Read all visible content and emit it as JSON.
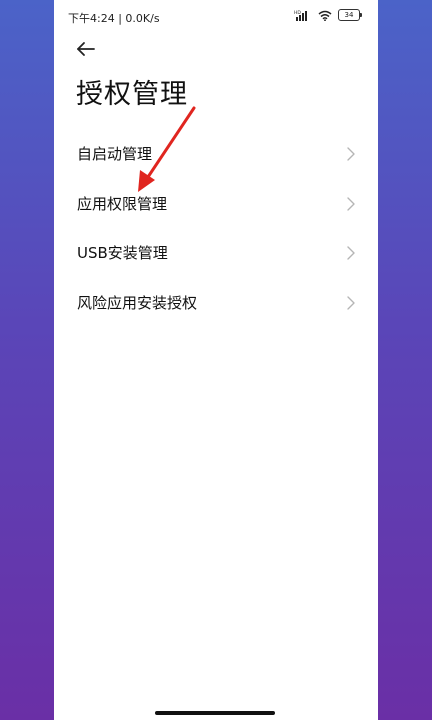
{
  "status_bar": {
    "time_speed": "下午4:24 | 0.0K/s",
    "network": "HD",
    "battery": "34"
  },
  "header": {
    "title": "授权管理"
  },
  "menu": {
    "items": [
      {
        "label": "自启动管理"
      },
      {
        "label": "应用权限管理"
      },
      {
        "label": "USB安装管理"
      },
      {
        "label": "风险应用安装授权"
      }
    ]
  },
  "colors": {
    "background_gradient_top": "#4b63c8",
    "background_gradient_bottom": "#6a2fa6",
    "annotation_arrow": "#e0251f",
    "chevron": "#b5b5b5"
  },
  "icons": {
    "back": "arrow-left-icon",
    "signal": "signal-icon",
    "wifi": "wifi-icon",
    "chevron": "chevron-right-icon"
  }
}
